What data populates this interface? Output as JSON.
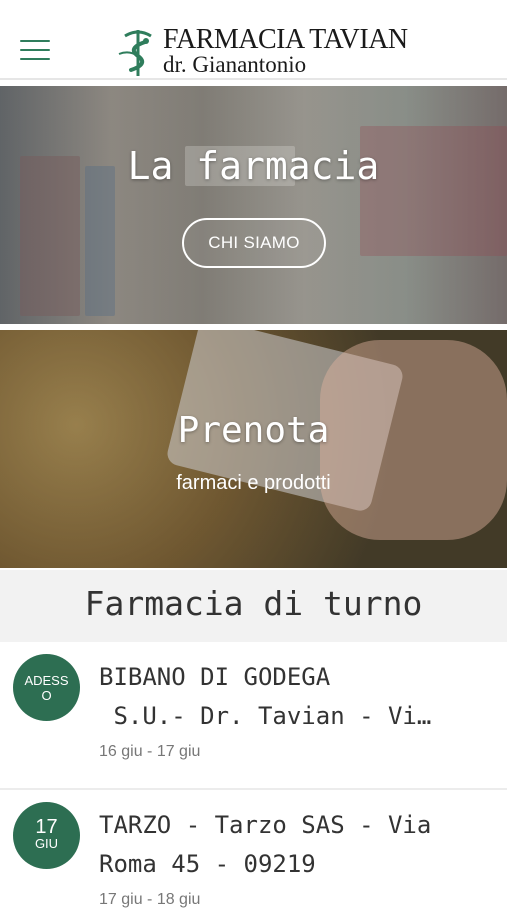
{
  "header": {
    "logo_line1": "FARMACIA TAVIAN",
    "logo_line2": "dr. Gianantonio",
    "brand_color": "#2f7d5c"
  },
  "cards": {
    "farmacia": {
      "title": "La farmacia",
      "button": "CHI SIAMO"
    },
    "prenota": {
      "title": "Prenota",
      "subtitle": "farmaci e prodotti"
    }
  },
  "section": {
    "title": "Farmacia di turno"
  },
  "turni": [
    {
      "badge": "ADESS\nO",
      "line1": "BIBANO DI GODEGA",
      "line2": " S.U.- Dr. Tavian - Vi…",
      "date": "16 giu - 17 giu"
    },
    {
      "badge_day": "17",
      "badge_month": "GIU",
      "line1": "TARZO - Tarzo SAS - Via",
      "line2": "Roma 45 - 09219",
      "date": "17 giu - 18 giu"
    }
  ],
  "colors": {
    "badge": "#2d6e52",
    "section_bg": "#f2f2f2"
  }
}
